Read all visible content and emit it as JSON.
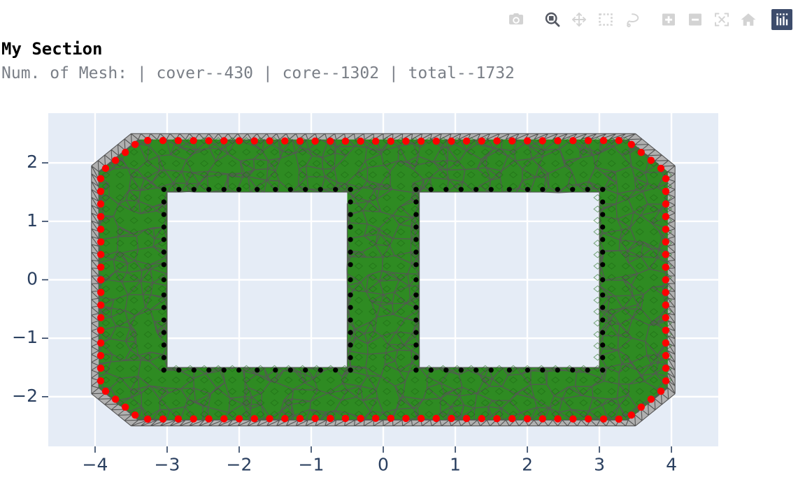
{
  "window": {
    "background": "#ffffff"
  },
  "modebar": {
    "buttons": [
      {
        "name": "download-plot-as-png-button",
        "icon": "camera-icon",
        "label": "Download plot as a png",
        "active": false,
        "color": "#d3d3d3"
      },
      {
        "name": "zoom-button",
        "icon": "zoom-magnifier-icon",
        "label": "Zoom",
        "active": true,
        "color": "#545862"
      },
      {
        "name": "pan-button",
        "icon": "pan-arrows-icon",
        "label": "Pan",
        "active": false,
        "color": "#d3d3d3"
      },
      {
        "name": "box-select-button",
        "icon": "box-select-icon",
        "label": "Box Select",
        "active": false,
        "color": "#d3d3d3"
      },
      {
        "name": "lasso-select-button",
        "icon": "lasso-select-icon",
        "label": "Lasso Select",
        "active": false,
        "color": "#d3d3d3"
      },
      {
        "name": "zoom-in-button",
        "icon": "plus-square-icon",
        "label": "Zoom in",
        "active": false,
        "color": "#d3d3d3"
      },
      {
        "name": "zoom-out-button",
        "icon": "minus-square-icon",
        "label": "Zoom out",
        "active": false,
        "color": "#d3d3d3"
      },
      {
        "name": "autoscale-button",
        "icon": "autoscale-expand-icon",
        "label": "Autoscale",
        "active": false,
        "color": "#d3d3d3"
      },
      {
        "name": "reset-axes-button",
        "icon": "home-icon",
        "label": "Reset axes",
        "active": false,
        "color": "#d3d3d3"
      },
      {
        "name": "plotly-logo-button",
        "icon": "plotly-bars-logo-icon",
        "label": "Produced with Plotly",
        "active": false,
        "color": "#ffffff"
      }
    ]
  },
  "header": {
    "title": "My Section",
    "subtitle": "Num. of Mesh: | cover--430 | core--1302 | total--1732"
  },
  "mesh_counts": {
    "cover": 430,
    "core": 1302,
    "total": 1732
  },
  "chart_data": {
    "type": "scatter",
    "title": "My Section",
    "subtitle": "Num. of Mesh: | cover--430 | core--1302 | total--1732",
    "xlabel": "",
    "ylabel": "",
    "xlim": [
      -4.65,
      4.65
    ],
    "ylim": [
      -2.85,
      2.85
    ],
    "xticks": [
      -4,
      -3,
      -2,
      -1,
      0,
      1,
      2,
      3,
      4
    ],
    "yticks": [
      -2,
      -1,
      0,
      1,
      2
    ],
    "grid": true,
    "grid_color": "#ffffff",
    "plot_bgcolor": "#e5ecf6",
    "paper_bgcolor": "#ffffff",
    "tick_font_color": "#2a3f5f",
    "legend_position": "none",
    "geometry": {
      "outer_polygon_note": "octagonal box, chamfered corners",
      "outer_half_width": 4.05,
      "outer_half_height": 2.5,
      "outer_chamfer": 0.55,
      "core_inset": 0.1,
      "holes": [
        {
          "name": "left-hole",
          "x0": -3.0,
          "x1": -0.5,
          "y0": -1.5,
          "y1": 1.5
        },
        {
          "name": "right-hole",
          "x0": 0.5,
          "x1": 3.0,
          "y0": -1.5,
          "y1": 1.5
        }
      ]
    },
    "series": [
      {
        "name": "cover mesh",
        "type": "mesh-band",
        "fill": "#b0b0b0",
        "line": "#4f4f4f",
        "count": 430
      },
      {
        "name": "core mesh",
        "type": "triangular-mesh",
        "fill": "#2e8b22",
        "line": "#555555",
        "count": 1302
      },
      {
        "name": "outer rebar",
        "type": "markers",
        "color": "#ff0000",
        "marker": "circle",
        "size": 9
      },
      {
        "name": "inner rebar",
        "type": "markers",
        "color": "#000000",
        "marker": "circle",
        "size": 6
      }
    ]
  }
}
